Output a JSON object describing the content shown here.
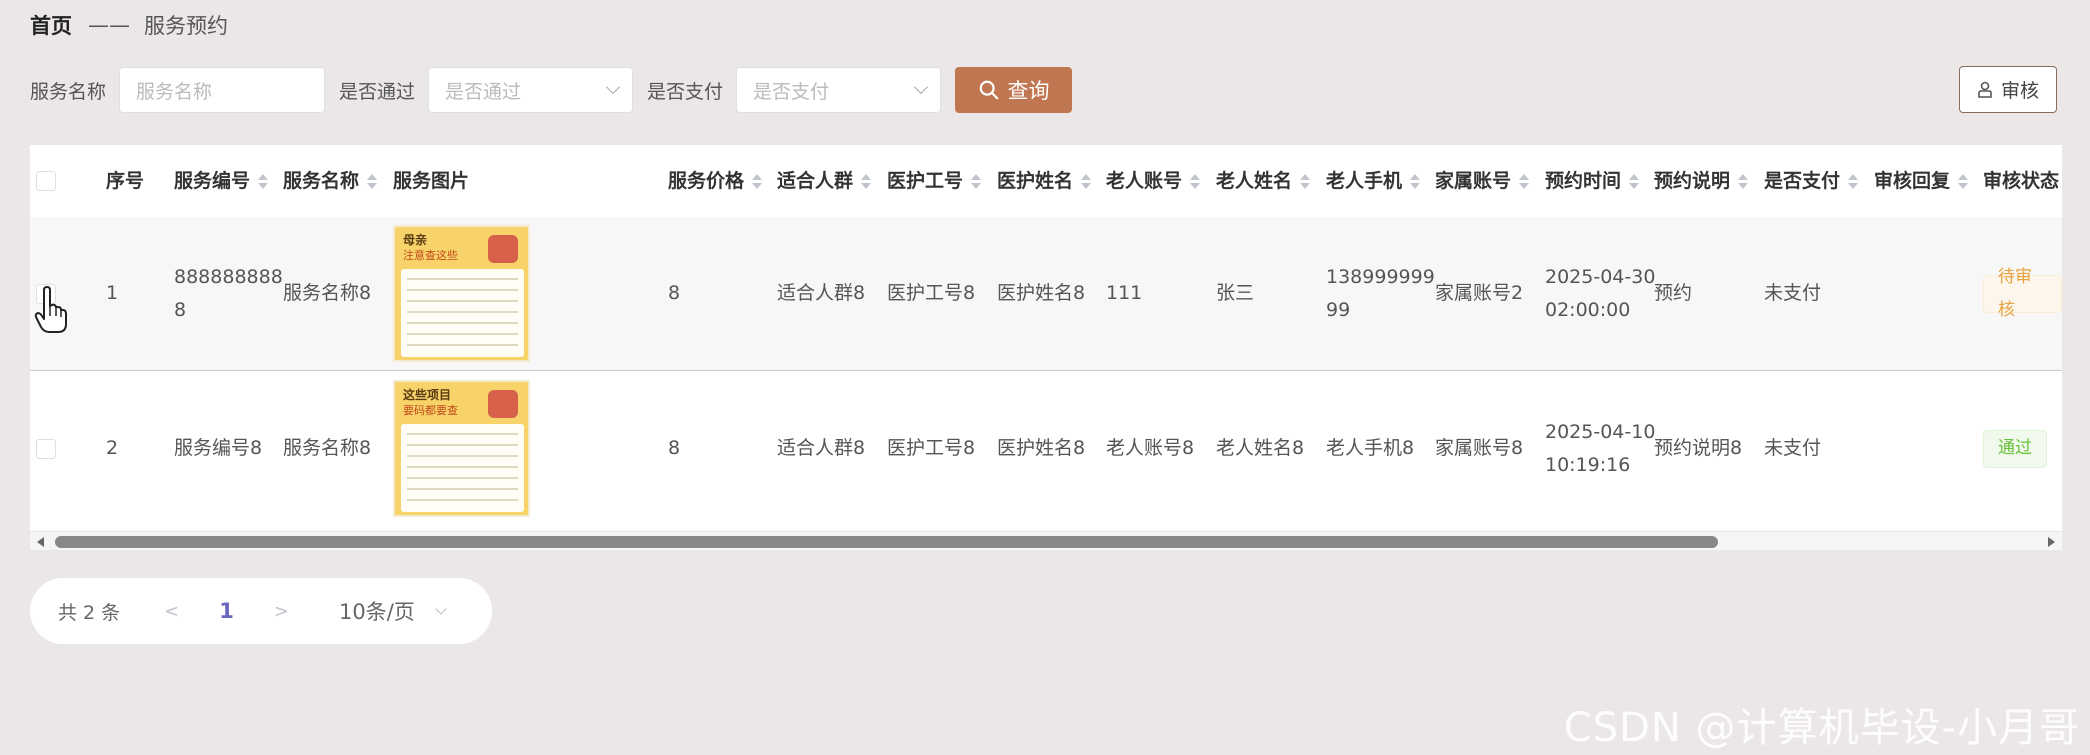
{
  "breadcrumb": {
    "home": "首页",
    "separator": "——",
    "current": "服务预约"
  },
  "search": {
    "service_name_label": "服务名称",
    "service_name_placeholder": "服务名称",
    "passed_label": "是否通过",
    "passed_placeholder": "是否通过",
    "paid_label": "是否支付",
    "paid_placeholder": "是否支付",
    "search_button": "查询"
  },
  "toolbar": {
    "audit_button": "审核"
  },
  "table": {
    "headers": {
      "index": "序号",
      "service_no": "服务编号",
      "service_name": "服务名称",
      "service_image": "服务图片",
      "price": "服务价格",
      "suitable": "适合人群",
      "nurse_no": "医护工号",
      "nurse_name": "医护姓名",
      "elder_account": "老人账号",
      "elder_name": "老人姓名",
      "elder_phone": "老人手机",
      "family_account": "家属账号",
      "booking_time": "预约时间",
      "booking_note": "预约说明",
      "paid": "是否支付",
      "audit_reply": "审核回复",
      "audit_status": "审核状态"
    },
    "rows": [
      {
        "index": "1",
        "service_no_l1": "888888888",
        "service_no_l2": "8",
        "service_name": "服务名称8",
        "image_title": "母亲",
        "image_sub": "注意查这些",
        "price": "8",
        "suitable": "适合人群8",
        "nurse_no": "医护工号8",
        "nurse_name": "医护姓名8",
        "elder_account": "111",
        "elder_name": "张三",
        "elder_phone_l1": "138999999",
        "elder_phone_l2": "99",
        "family_account": "家属账号2",
        "booking_date": "2025-04-30",
        "booking_clock": "02:00:00",
        "booking_note": "预约",
        "paid": "未支付",
        "audit_reply": "",
        "audit_status": "待审核"
      },
      {
        "index": "2",
        "service_no": "服务编号8",
        "service_name": "服务名称8",
        "image_title": "这些项目",
        "image_sub": "要码都要查",
        "price": "8",
        "suitable": "适合人群8",
        "nurse_no": "医护工号8",
        "nurse_name": "医护姓名8",
        "elder_account": "老人账号8",
        "elder_name": "老人姓名8",
        "elder_phone": "老人手机8",
        "family_account": "家属账号8",
        "booking_date": "2025-04-10",
        "booking_clock": "10:19:16",
        "booking_note": "预约说明8",
        "paid": "未支付",
        "audit_reply": "",
        "audit_status": "通过"
      }
    ]
  },
  "pagination": {
    "total": "共 2 条",
    "prev": "<",
    "page": "1",
    "next": ">",
    "page_size": "10条/页"
  },
  "watermark": "CSDN @计算机毕设-小月哥",
  "colors": {
    "primary": "#c07650",
    "pending": "#e6a23c",
    "pass": "#67c23a",
    "page_active": "#6a67c2"
  }
}
